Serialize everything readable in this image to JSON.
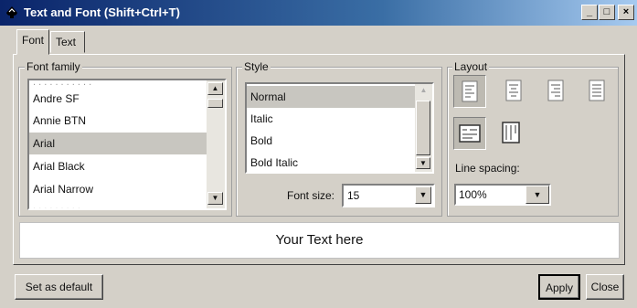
{
  "window": {
    "title": "Text and Font (Shift+Ctrl+T)",
    "minimize": "_",
    "maximize": "□",
    "close": "×"
  },
  "tabs": [
    {
      "label": "Font"
    },
    {
      "label": "Text"
    }
  ],
  "font_family": {
    "label": "Font family",
    "items": [
      "Andre SF",
      "Annie BTN",
      "Arial",
      "Arial Black",
      "Arial Narrow"
    ],
    "selected": "Arial"
  },
  "style": {
    "label": "Style",
    "items": [
      "Normal",
      "Italic",
      "Bold",
      "Bold Italic"
    ],
    "selected": "Normal",
    "font_size_label": "Font size:",
    "font_size_value": "15"
  },
  "layout": {
    "label": "Layout",
    "alignments": [
      "align-left",
      "align-center",
      "align-right",
      "align-justify"
    ],
    "active_alignment": "align-left",
    "orientations": [
      "horizontal-text",
      "vertical-text"
    ],
    "active_orientation": "horizontal-text",
    "line_spacing_label": "Line spacing:",
    "line_spacing_value": "100%"
  },
  "preview": {
    "text": "Your Text here"
  },
  "buttons": {
    "set_default": "Set as default",
    "apply": "Apply",
    "close": "Close"
  }
}
